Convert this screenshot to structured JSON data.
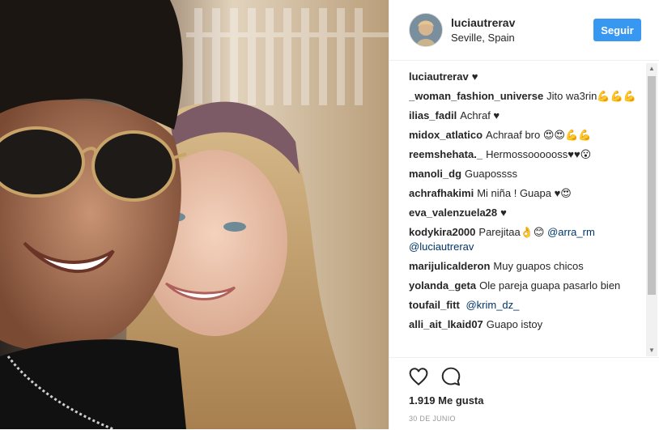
{
  "post": {
    "username": "luciautrerav",
    "location": "Seville, Spain",
    "follow_label": "Seguir",
    "likes": "1.919 Me gusta",
    "date": "30 DE JUNIO"
  },
  "comments": [
    {
      "user": "luciautrerav",
      "text": "♥"
    },
    {
      "user": "_woman_fashion_universe",
      "text": "Jito wa3rin💪💪💪"
    },
    {
      "user": "ilias_fadil",
      "text": "Achraf ♥"
    },
    {
      "user": "midox_atlatico",
      "text": "Achraaf bro 😍😍💪💪"
    },
    {
      "user": "reemshehata._",
      "text": "Hermossoooooss♥♥😮"
    },
    {
      "user": "manoli_dg",
      "text": "Guapossss"
    },
    {
      "user": "achrafhakimi",
      "text": "Mi niña ! Guapa ♥😍"
    },
    {
      "user": "eva_valenzuela28",
      "text": "♥"
    },
    {
      "user": "kodykira2000",
      "text": "Parejitaa👌😊",
      "mentions": [
        "@arra_rm",
        "@luciautrerav"
      ]
    },
    {
      "user": "marijulicalderon",
      "text": "Muy guapos chicos"
    },
    {
      "user": "yolanda_geta",
      "text": "Ole pareja guapa pasarlo bien"
    },
    {
      "user": "toufail_fitt",
      "text": "",
      "mentions": [
        "@krim_dz_"
      ]
    },
    {
      "user": "alli_ait_lkaid07",
      "text": "Guapo istoy"
    }
  ],
  "colors": {
    "follow_button": "#3897f0",
    "mention": "#003569",
    "date": "#999999"
  },
  "icons": {
    "like": "heart-outline-icon",
    "comment": "speech-bubble-icon"
  }
}
